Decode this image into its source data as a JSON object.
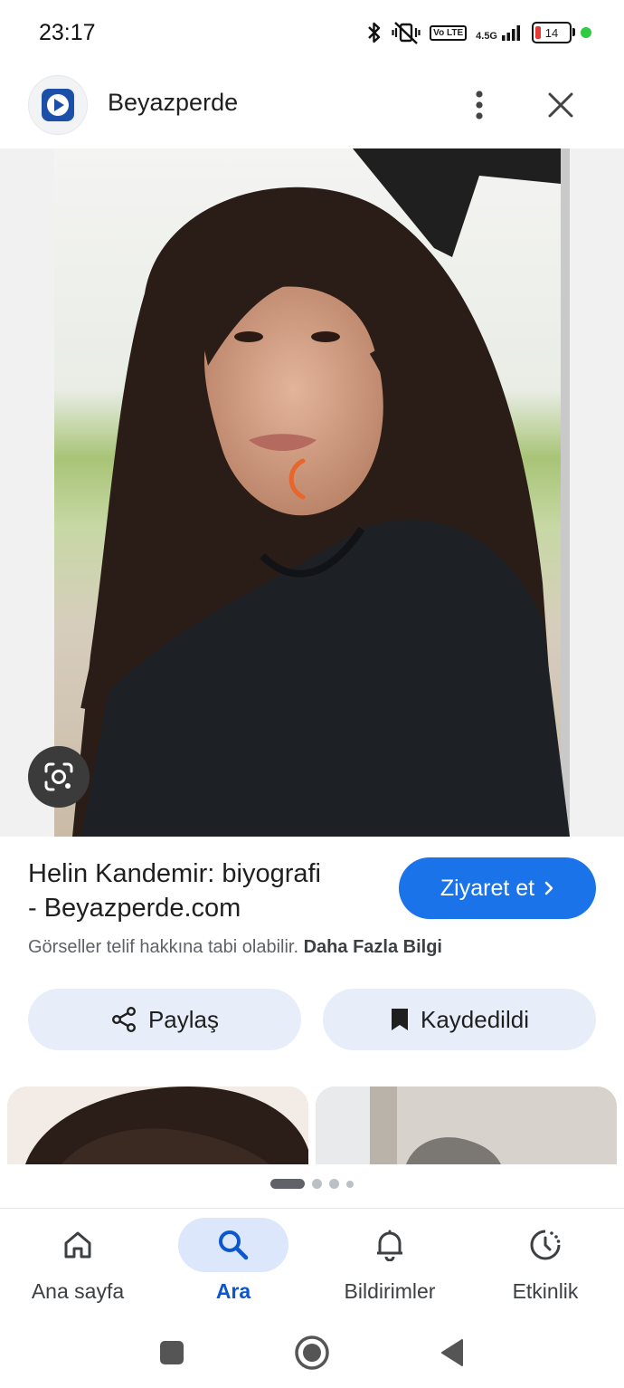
{
  "status": {
    "time": "23:17",
    "network": "4.5G",
    "lte": "Vo LTE",
    "battery": "14"
  },
  "header": {
    "site_name": "Beyazperde"
  },
  "result": {
    "title_line1": "Helin Kandemir: biyografi",
    "title_line2": "- Beyazperde.com",
    "visit_label": "Ziyaret et",
    "copyright_text": "Görseller telif hakkına tabi olabilir.",
    "more_info": "Daha Fazla Bilgi"
  },
  "actions": {
    "share_label": "Paylaş",
    "save_label": "Kaydedildi"
  },
  "pager": {
    "current": 1,
    "total": 4
  },
  "bottom_nav": {
    "items": [
      {
        "label": "Ana sayfa",
        "icon": "home-icon"
      },
      {
        "label": "Ara",
        "icon": "search-icon",
        "active": true
      },
      {
        "label": "Bildirimler",
        "icon": "bell-icon"
      },
      {
        "label": "Etkinlik",
        "icon": "activity-icon"
      }
    ]
  },
  "colors": {
    "accent": "#1a73e8",
    "active_tab": "#0b57d0",
    "pill_bg": "#e8eef9"
  }
}
